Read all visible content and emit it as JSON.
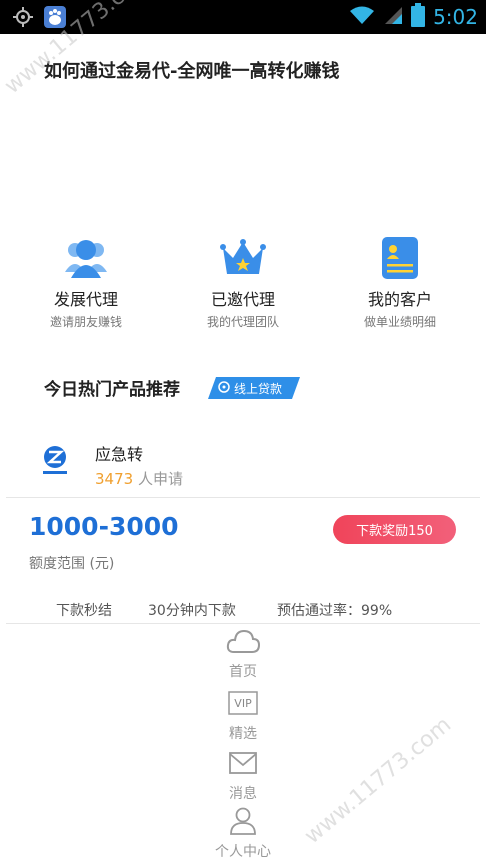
{
  "status_bar": {
    "time": "5:02"
  },
  "page_title": "如何通过金易代-全网唯一高转化赚钱",
  "actions": [
    {
      "label": "发展代理",
      "sub": "邀请朋友赚钱",
      "icon": "users-icon"
    },
    {
      "label": "已邀代理",
      "sub": "我的代理团队",
      "icon": "crown-icon"
    },
    {
      "label": "我的客户",
      "sub": "做单业绩明细",
      "icon": "contact-card-icon"
    }
  ],
  "section": {
    "title": "今日热门产品推荐",
    "badge": "线上贷款"
  },
  "product": {
    "name": "应急转",
    "apply_count": "3473",
    "apply_suffix": " 人申请",
    "amount_range": "1000-3000",
    "reward": "下款奖励150",
    "amount_label": "额度范围 (元)",
    "features": [
      "下款秒结",
      "30分钟内下款",
      "预估通过率：99%"
    ]
  },
  "nav": [
    {
      "label": "首页",
      "icon": "cloud-icon"
    },
    {
      "label": "精选",
      "icon": "vip-icon"
    },
    {
      "label": "消息",
      "icon": "mail-icon"
    },
    {
      "label": "个人中心",
      "icon": "person-icon"
    }
  ],
  "watermark": {
    "text": "www.11773.com"
  },
  "colors": {
    "accent": "#1e6fd6",
    "badge": "#2e8fe8",
    "reward": "#f0445a",
    "count": "#f0a030"
  }
}
